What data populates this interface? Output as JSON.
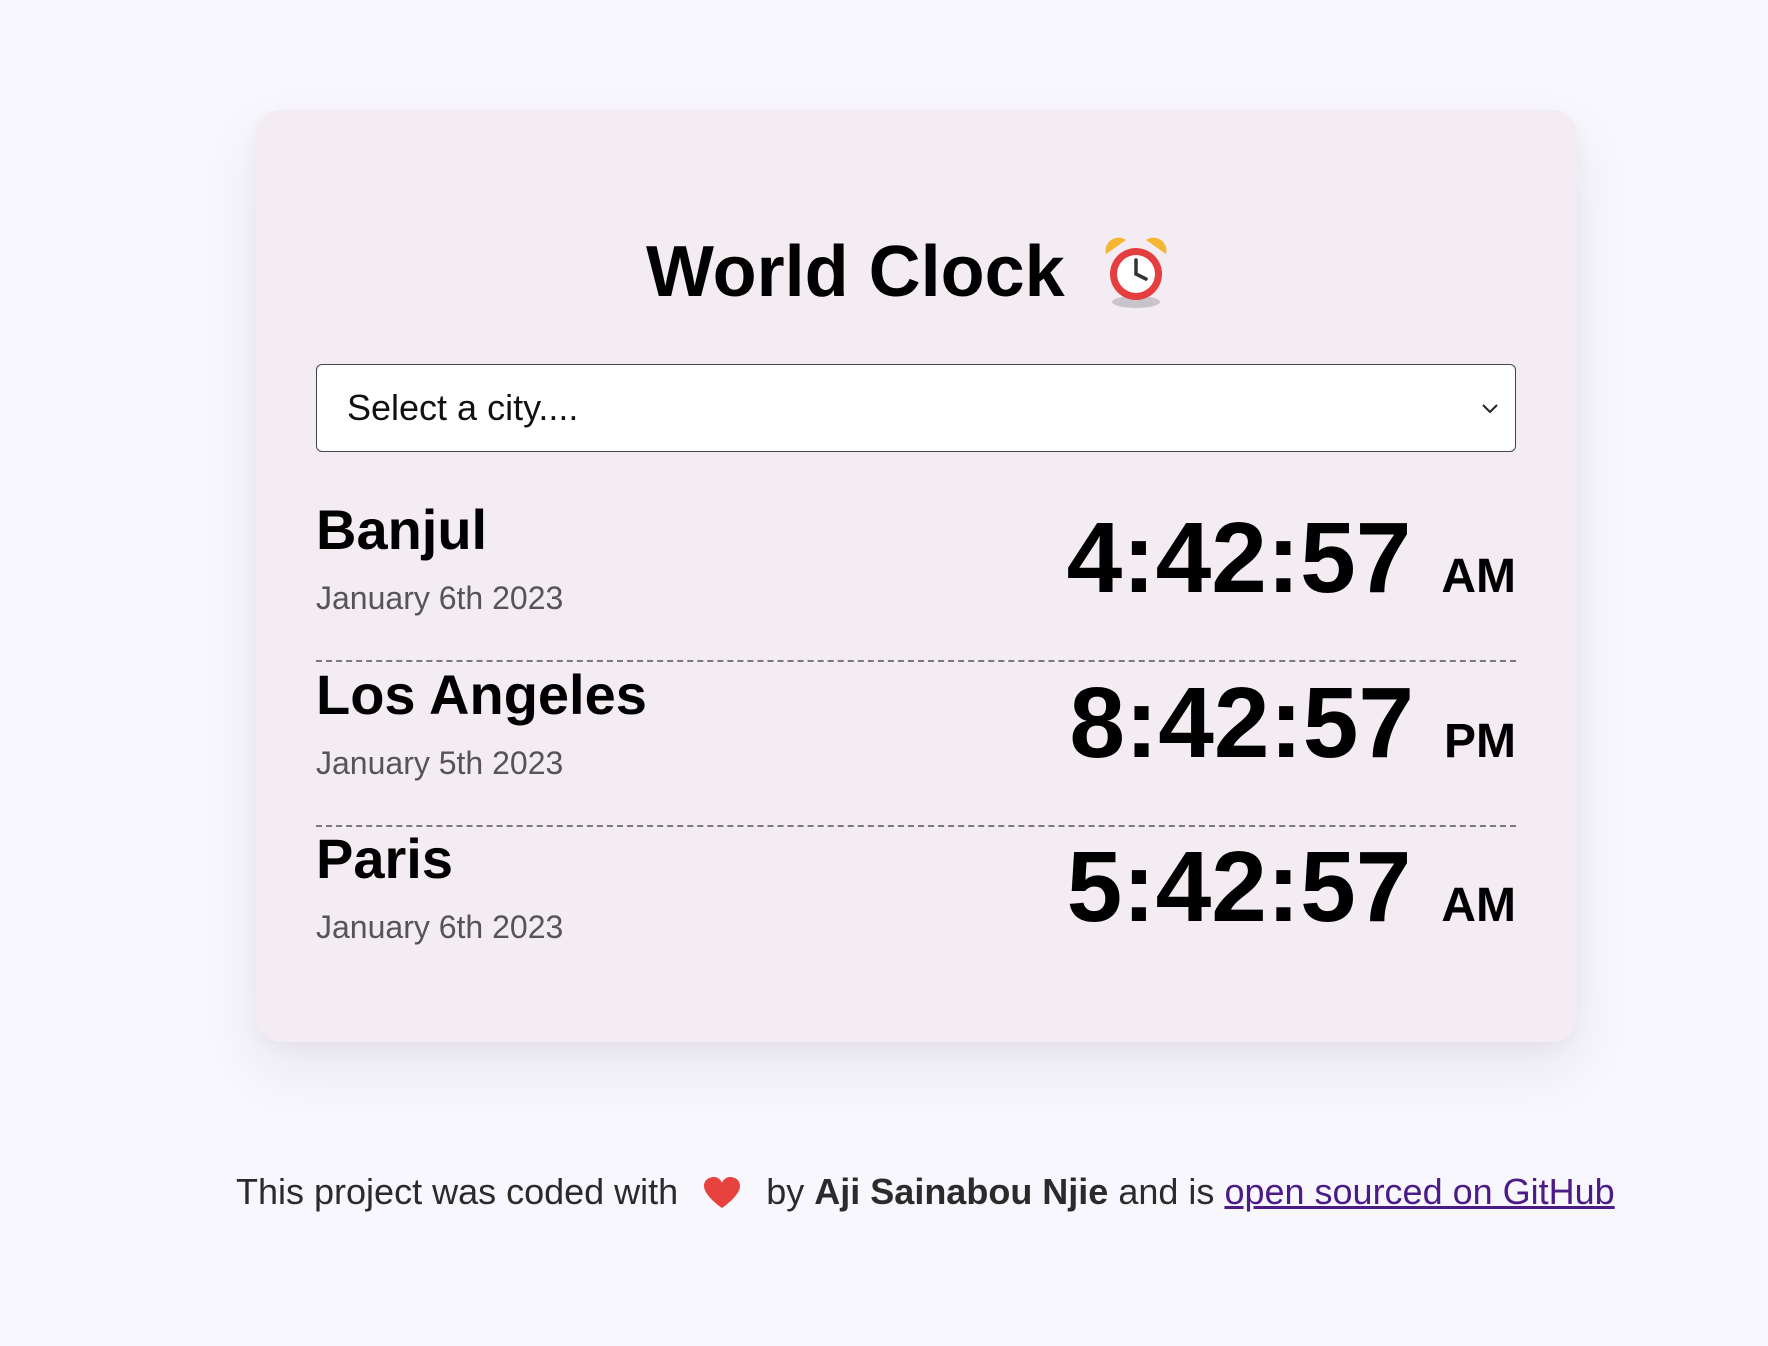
{
  "app": {
    "title": "World Clock"
  },
  "select": {
    "placeholder": "Select a city...."
  },
  "cities": [
    {
      "name": "Banjul",
      "date": "January 6th 2023",
      "time": "4:42:57",
      "ampm": "AM"
    },
    {
      "name": "Los Angeles",
      "date": "January 5th 2023",
      "time": "8:42:57",
      "ampm": "PM"
    },
    {
      "name": "Paris",
      "date": "January 6th 2023",
      "time": "5:42:57",
      "ampm": "AM"
    }
  ],
  "footer": {
    "prefix": "This project was coded with",
    "by": "by",
    "author": "Aji Sainabou Njie",
    "middle": "and is",
    "link_text": "open sourced on GitHub"
  },
  "icons": {
    "title_icon": "alarm-clock-icon",
    "heart": "heart-icon",
    "dropdown": "chevron-down-icon"
  },
  "colors": {
    "page_background": "#f8f7fd",
    "card_background": "#f3ecf2",
    "link": "#4b1b86",
    "heart": "#e8423f"
  }
}
